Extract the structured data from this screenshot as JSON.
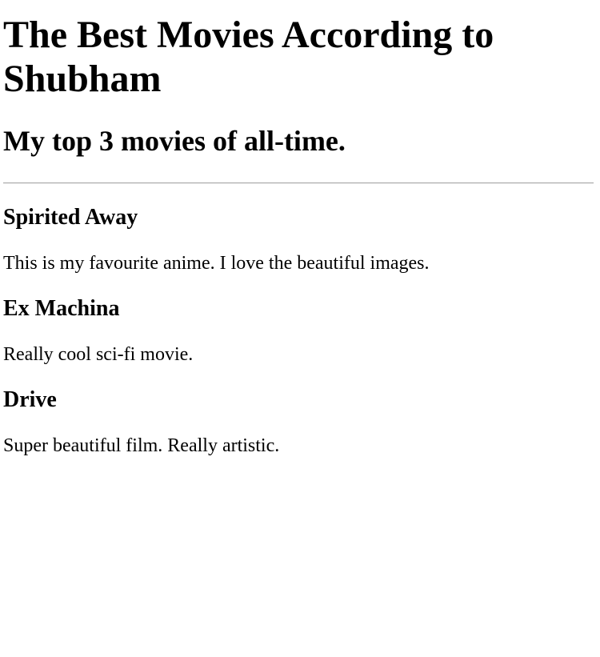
{
  "page": {
    "title": "The Best Movies According to Shubham",
    "subtitle": "My top 3 movies of all-time."
  },
  "movies": [
    {
      "title": "Spirited Away",
      "description": "This is my favourite anime. I love the beautiful images."
    },
    {
      "title": "Ex Machina",
      "description": "Really cool sci-fi movie."
    },
    {
      "title": "Drive",
      "description": "Super beautiful film. Really artistic."
    }
  ]
}
